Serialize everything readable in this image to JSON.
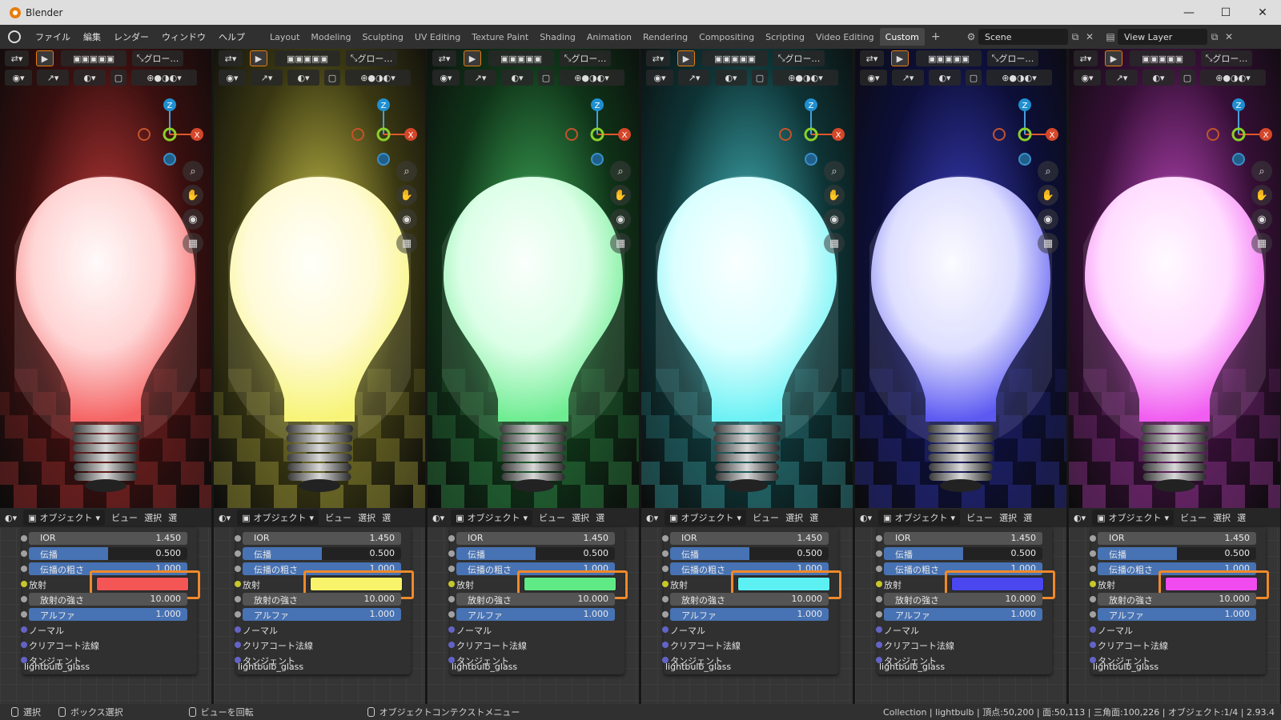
{
  "app": {
    "title": "Blender",
    "window_buttons": [
      "—",
      "☐",
      "✕"
    ]
  },
  "menu": [
    "ファイル",
    "編集",
    "レンダー",
    "ウィンドウ",
    "ヘルプ"
  ],
  "workspaces": [
    "Layout",
    "Modeling",
    "Sculpting",
    "UV Editing",
    "Texture Paint",
    "Shading",
    "Animation",
    "Rendering",
    "Compositing",
    "Scripting",
    "Video Editing",
    "Custom"
  ],
  "active_workspace": "Custom",
  "add_workspace": "+",
  "scene": {
    "name": "Scene",
    "view_layer": "View Layer"
  },
  "header": {
    "transform": "グロー…",
    "object_mode": "オブジェクト",
    "view": "ビュー",
    "select": "選択",
    "select_short": "選"
  },
  "gizmo": {
    "z": "Z",
    "x": "X"
  },
  "node": {
    "ior_label": "IOR",
    "ior_value": "1.450",
    "transmission_label": "伝播",
    "transmission_value": "0.500",
    "trans_rough_label": "伝播の粗さ",
    "trans_rough_value": "1.000",
    "emission_label": "放射",
    "emission_strength_label": "放射の強さ",
    "emission_strength_value": "10.000",
    "alpha_label": "アルファ",
    "alpha_value": "1.000",
    "normal_label": "ノーマル",
    "clearcoat_normal_label": "クリアコート法線",
    "tangent_label": "タンジェント",
    "material_name": "lightbulb_glass"
  },
  "panels": [
    {
      "emission_color": "#f45555",
      "tint": "#c43a3a",
      "glow": "#ffd6d6",
      "dark": "#3a0f0f"
    },
    {
      "emission_color": "#f7f36a",
      "tint": "#c9c24a",
      "glow": "#fffbd9",
      "dark": "#3a3812"
    },
    {
      "emission_color": "#5fea86",
      "tint": "#3fae5a",
      "glow": "#dcffe8",
      "dark": "#0f3318"
    },
    {
      "emission_color": "#5cf0f3",
      "tint": "#44b8bd",
      "glow": "#dcffff",
      "dark": "#0e3436"
    },
    {
      "emission_color": "#4a47f0",
      "tint": "#3b3fc0",
      "glow": "#dfe0ff",
      "dark": "#0d0f3a"
    },
    {
      "emission_color": "#ef4bef",
      "tint": "#c048c0",
      "glow": "#ffdcff",
      "dark": "#360f36"
    }
  ],
  "status": {
    "select": "選択",
    "box_select": "ボックス選択",
    "rotate_view": "ビューを回転",
    "context_menu": "オブジェクトコンテクストメニュー",
    "stats": "Collection | lightbulb | 頂点:50,200 | 面:50,113 | 三角面:100,226 | オブジェクト:1/4 | 2.93.4"
  }
}
